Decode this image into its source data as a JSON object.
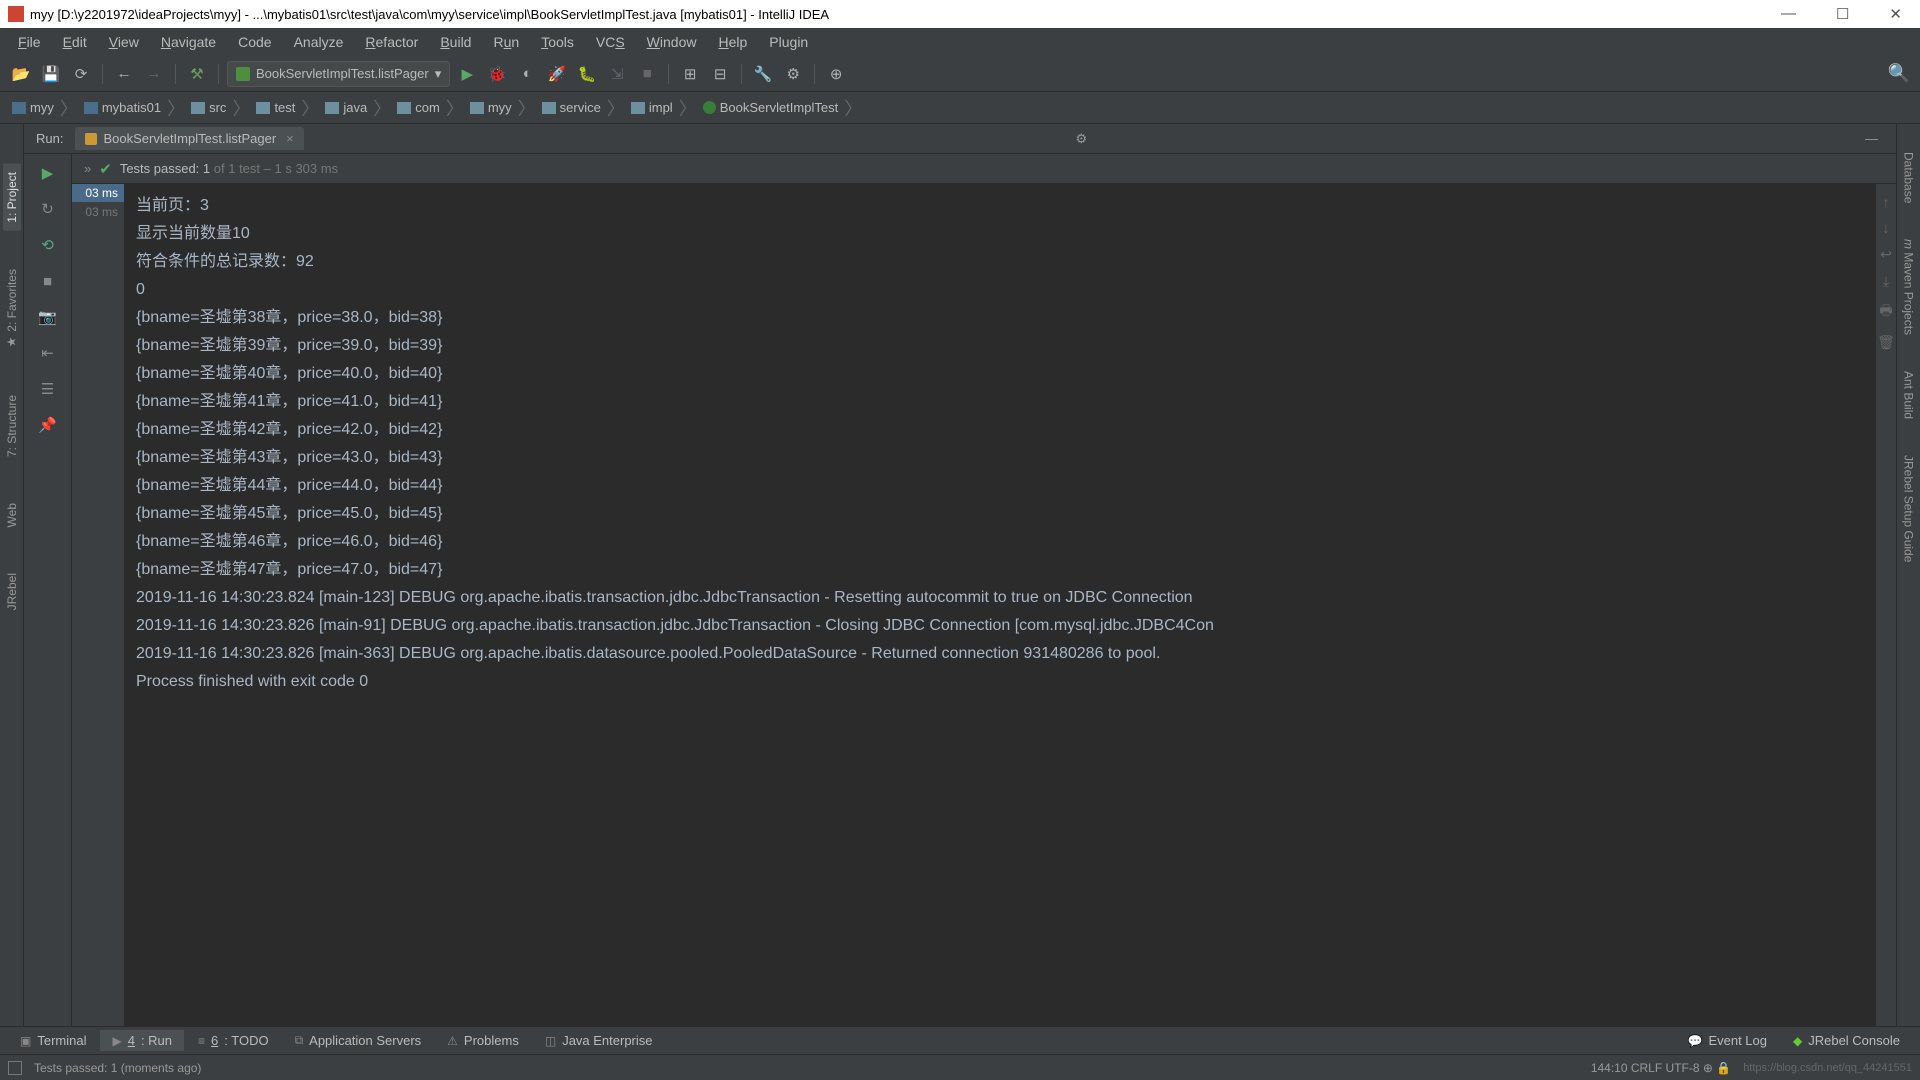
{
  "window": {
    "title": "myy [D:\\y2201972\\ideaProjects\\myy] - ...\\mybatis01\\src\\test\\java\\com\\myy\\service\\impl\\BookServletImplTest.java [mybatis01] - IntelliJ IDEA"
  },
  "menu": {
    "file": "File",
    "edit": "Edit",
    "view": "View",
    "navigate": "Navigate",
    "code": "Code",
    "analyze": "Analyze",
    "refactor": "Refactor",
    "build": "Build",
    "run": "Run",
    "tools": "Tools",
    "vcs": "VCS",
    "window": "Window",
    "help": "Help",
    "plugin": "Plugin"
  },
  "toolbar": {
    "run_config": "BookServletImplTest.listPager"
  },
  "breadcrumb": {
    "items": [
      "myy",
      "mybatis01",
      "src",
      "test",
      "java",
      "com",
      "myy",
      "service",
      "impl",
      "BookServletImplTest"
    ]
  },
  "left_tabs": {
    "project": "1: Project",
    "favorites": "2: Favorites",
    "structure": "7: Structure",
    "web": "Web",
    "jrebel": "JRebel"
  },
  "right_tabs": {
    "database": "Database",
    "maven": "Maven Projects",
    "ant": "Ant Build",
    "jrebel": "JRebel Setup Guide"
  },
  "run_panel": {
    "label": "Run:",
    "tab": "BookServletImplTest.listPager",
    "tests_prefix": "Tests passed: ",
    "tests_count": "1",
    "tests_mid": " of 1 test",
    "tests_time": " – 1 s 303 ms",
    "time_badge1": "03 ms",
    "time_badge2": "03 ms"
  },
  "console_lines": [
    "当前页：3",
    "显示当前数量10",
    "符合条件的总记录数：92",
    "0",
    "{bname=圣墟第38章，price=38.0，bid=38}",
    "{bname=圣墟第39章，price=39.0，bid=39}",
    "{bname=圣墟第40章，price=40.0，bid=40}",
    "{bname=圣墟第41章，price=41.0，bid=41}",
    "{bname=圣墟第42章，price=42.0，bid=42}",
    "{bname=圣墟第43章，price=43.0，bid=43}",
    "{bname=圣墟第44章，price=44.0，bid=44}",
    "{bname=圣墟第45章，price=45.0，bid=45}",
    "{bname=圣墟第46章，price=46.0，bid=46}",
    "{bname=圣墟第47章，price=47.0，bid=47}",
    "2019-11-16 14:30:23.824 [main-123] DEBUG org.apache.ibatis.transaction.jdbc.JdbcTransaction - Resetting autocommit to true on JDBC Connection",
    "2019-11-16 14:30:23.826 [main-91] DEBUG org.apache.ibatis.transaction.jdbc.JdbcTransaction - Closing JDBC Connection [com.mysql.jdbc.JDBC4Con",
    "2019-11-16 14:30:23.826 [main-363] DEBUG org.apache.ibatis.datasource.pooled.PooledDataSource - Returned connection 931480286 to pool.",
    "",
    "Process finished with exit code 0"
  ],
  "bottom_tabs": {
    "terminal": "Terminal",
    "run": "4: Run",
    "todo": "6: TODO",
    "appserv": "Application Servers",
    "problems": "Problems",
    "je": "Java Enterprise",
    "eventlog": "Event Log",
    "jrebel": "JRebel Console"
  },
  "status": {
    "msg": "Tests passed: 1 (moments ago)",
    "pos": "144:10 CRLF‎ ‎UTF-8‎ ‎⊕‎ ‎🔒",
    "watermark": "https://blog.csdn.net/qq_44241551"
  }
}
